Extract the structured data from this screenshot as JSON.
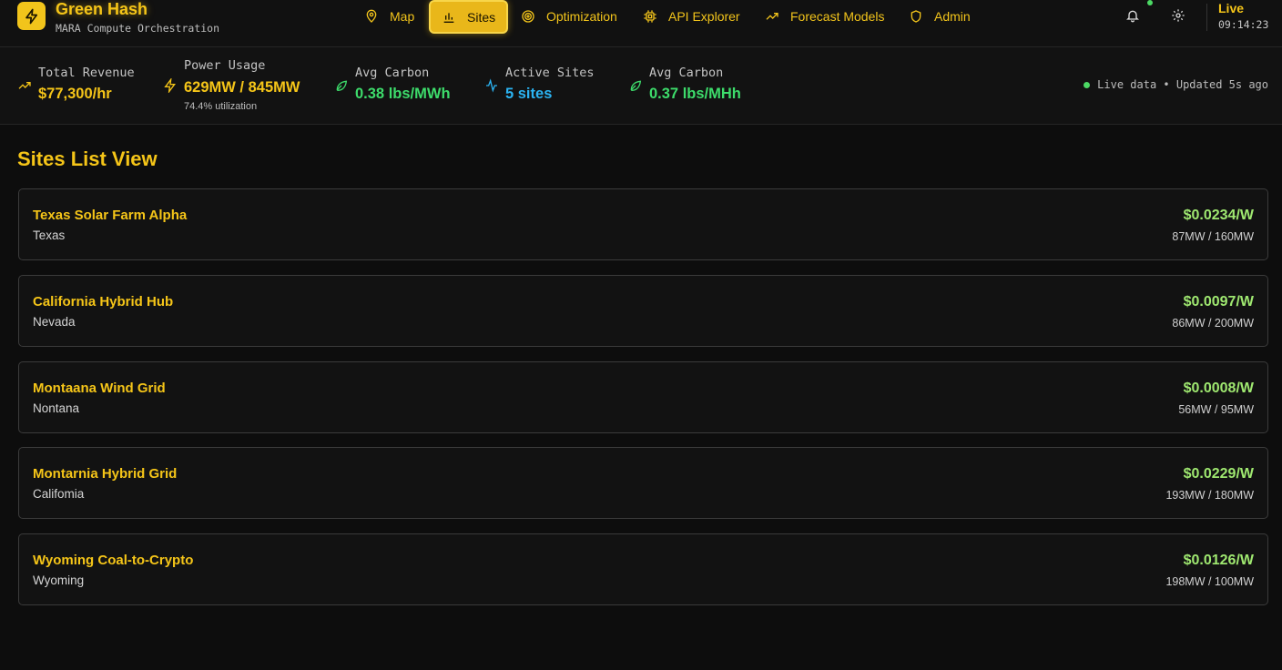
{
  "brand": {
    "title": "Green Hash",
    "subtitle": "MARA Compute Orchestration"
  },
  "nav": {
    "items": [
      {
        "label": "Map",
        "icon": "map-pin-icon",
        "active": false
      },
      {
        "label": "Sites",
        "icon": "bar-chart-icon",
        "active": true
      },
      {
        "label": "Optimization",
        "icon": "target-icon",
        "active": false
      },
      {
        "label": "API Explorer",
        "icon": "cpu-chip-icon",
        "active": false
      },
      {
        "label": "Forecast Models",
        "icon": "trending-up-icon",
        "active": false
      },
      {
        "label": "Admin",
        "icon": "shield-icon",
        "active": false
      }
    ]
  },
  "header_right": {
    "bell_icon": "bell-icon",
    "settings_icon": "gear-icon",
    "live_label": "Live",
    "time": "09:14:23"
  },
  "metrics": [
    {
      "label": "Total Revenue",
      "value": "$77,300/hr",
      "sub": "",
      "icon": "trending-up-icon",
      "color": "#f5c518"
    },
    {
      "label": "Power Usage",
      "value": "629MW / 845MW",
      "sub": "74.4% utilization",
      "icon": "lightning-icon",
      "color": "#f5c518"
    },
    {
      "label": "Avg Carbon",
      "value": "0.38 lbs/MWh",
      "sub": "",
      "icon": "leaf-icon",
      "color": "#3ddc6b"
    },
    {
      "label": "Active Sites",
      "value": "5 sites",
      "sub": "",
      "icon": "activity-icon",
      "color": "#2bb3f2"
    },
    {
      "label": "Avg Carbon",
      "value": "0.37 lbs/MHh",
      "sub": "",
      "icon": "leaf-icon",
      "color": "#3ddc6b"
    }
  ],
  "live_status": "Live data • Updated 5s ago",
  "page_title": "Sites List View",
  "sites": [
    {
      "name": "Texas Solar Farm Alpha",
      "location": "Texas",
      "price": "$0.0234/W",
      "capacity": "87MW / 160MW"
    },
    {
      "name": "California Hybrid Hub",
      "location": "Nevada",
      "price": "$0.0097/W",
      "capacity": "86MW / 200MW"
    },
    {
      "name": "Montaana Wind Grid",
      "location": "Nontana",
      "price": "$0.0008/W",
      "capacity": "56MW / 95MW"
    },
    {
      "name": "Montarnia Hybrid Grid",
      "location": "Califomia",
      "price": "$0.0229/W",
      "capacity": "193MW / 180MW"
    },
    {
      "name": "Wyoming Coal-to-Crypto",
      "location": "Wyoming",
      "price": "$0.0126/W",
      "capacity": "198MW / 100MW"
    }
  ],
  "colors": {
    "accent": "#f5c518",
    "price_green": "#9fe870",
    "carbon_green": "#3ddc6b",
    "sites_blue": "#2bb3f2",
    "background": "#0d0d0d"
  }
}
